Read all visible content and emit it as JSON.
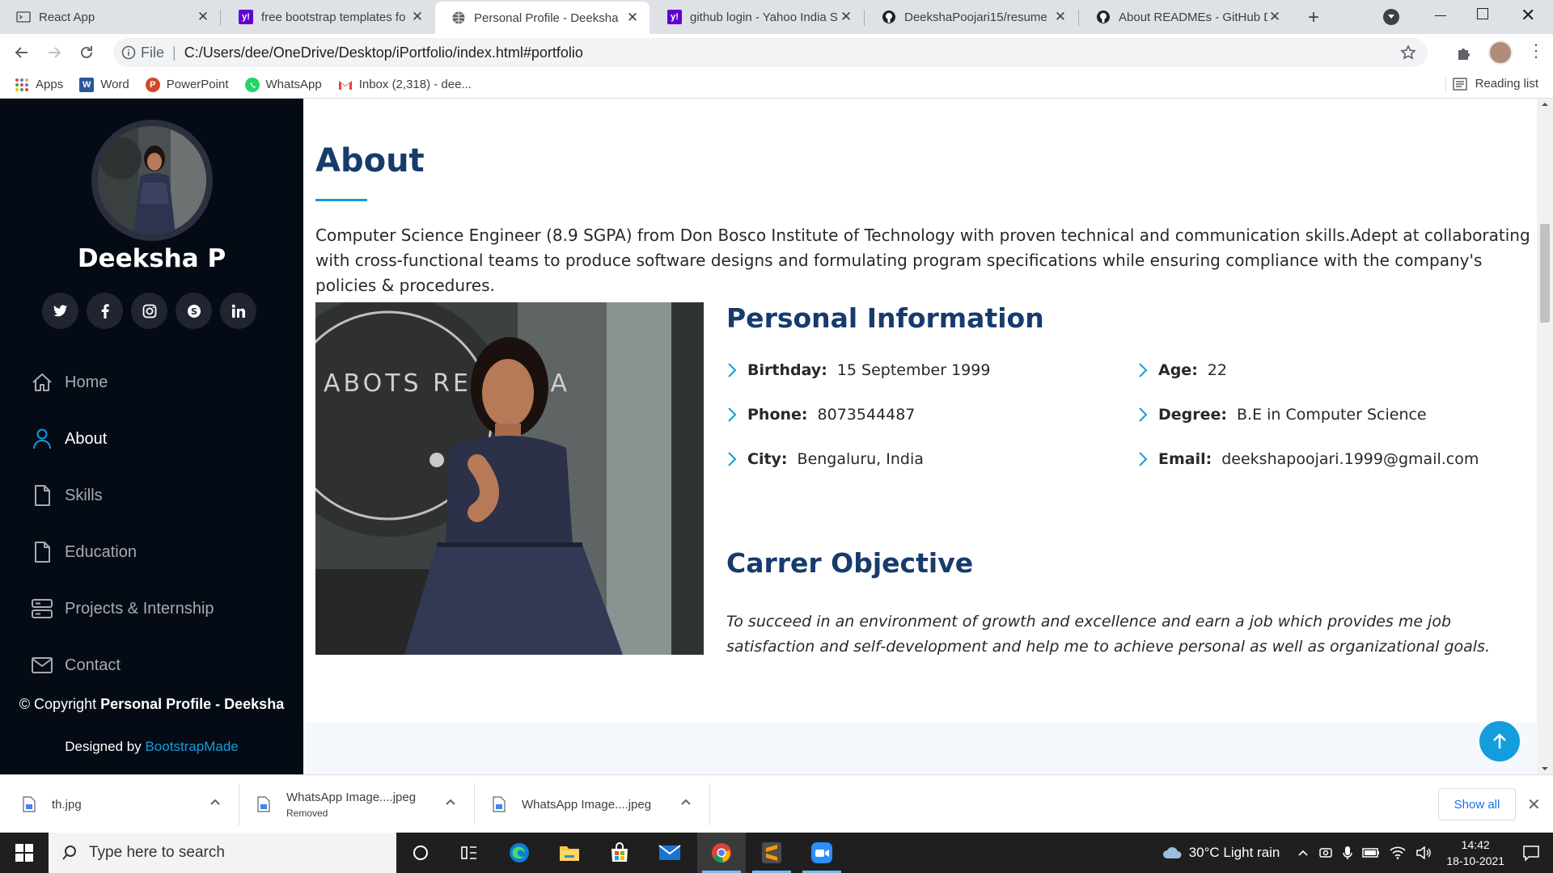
{
  "browser": {
    "tabs": [
      {
        "title": "React App",
        "favicon": "react-icon"
      },
      {
        "title": "free bootstrap templates fo",
        "favicon": "yahoo-icon"
      },
      {
        "title": "Personal Profile - Deeksha",
        "favicon": "globe-icon",
        "active": true
      },
      {
        "title": "github login - Yahoo India S",
        "favicon": "yahoo-icon"
      },
      {
        "title": "DeekshaPoojari15/resume",
        "favicon": "github-icon"
      },
      {
        "title": "About READMEs - GitHub D",
        "favicon": "github-icon"
      }
    ],
    "address": {
      "scheme_label": "File",
      "url": "C:/Users/dee/OneDrive/Desktop/iPortfolio/index.html#portfolio"
    },
    "bookmarks": [
      {
        "label": "Apps",
        "icon": "apps-grid-icon"
      },
      {
        "label": "Word",
        "icon": "word-icon"
      },
      {
        "label": "PowerPoint",
        "icon": "powerpoint-icon"
      },
      {
        "label": "WhatsApp",
        "icon": "whatsapp-icon"
      },
      {
        "label": "Inbox (2,318) - dee...",
        "icon": "gmail-icon"
      }
    ],
    "reading_list": "Reading list"
  },
  "sidebar": {
    "name": "Deeksha P",
    "socials": [
      "twitter",
      "facebook",
      "instagram",
      "skype",
      "linkedin"
    ],
    "nav": [
      {
        "label": "Home",
        "icon": "home-icon"
      },
      {
        "label": "About",
        "icon": "user-icon",
        "active": true
      },
      {
        "label": "Skills",
        "icon": "file-icon"
      },
      {
        "label": "Education",
        "icon": "file-icon"
      },
      {
        "label": "Projects & Internship",
        "icon": "server-icon"
      },
      {
        "label": "Contact",
        "icon": "envelope-icon"
      }
    ],
    "copyright_prefix": "© Copyright",
    "copyright_strong": "Personal Profile - Deeksha",
    "designed_by_prefix": "Designed by",
    "designed_by_link": "BootstrapMade"
  },
  "about": {
    "title": "About",
    "intro": "Computer Science Engineer (8.9 SGPA) from Don Bosco Institute of Technology with proven technical and communication skills.Adept at collaborating with cross-functional teams to produce software designs and formulating program specifications while ensuring compliance with the company's policies & procedures.",
    "personal_info_title": "Personal Information",
    "info": {
      "birthday": {
        "label": "Birthday:",
        "value": "15 September 1999"
      },
      "phone": {
        "label": "Phone:",
        "value": "8073544487"
      },
      "city": {
        "label": "City:",
        "value": "Bengaluru, India"
      },
      "age": {
        "label": "Age:",
        "value": "22"
      },
      "degree": {
        "label": "Degree:",
        "value": "B.E in Computer Science"
      },
      "email": {
        "label": "Email:",
        "value": "deekshapoojari.1999@gmail.com"
      }
    },
    "objective_title": "Carrer Objective",
    "objective": "To succeed in an environment of growth and excellence and earn a job which provides me job satisfaction and self-development and help me to achieve personal as well as organizational goals."
  },
  "downloads": {
    "items": [
      {
        "name": "th.jpg",
        "status": ""
      },
      {
        "name": "WhatsApp Image....jpeg",
        "status": "Removed"
      },
      {
        "name": "WhatsApp Image....jpeg",
        "status": ""
      }
    ],
    "show_all": "Show all"
  },
  "taskbar": {
    "search_placeholder": "Type here to search",
    "weather": "30°C  Light rain",
    "time": "14:42",
    "date": "18-10-2021"
  },
  "colors": {
    "accent": "#149ddd",
    "heading": "#173b6c",
    "sidebar_bg": "#040b14"
  }
}
